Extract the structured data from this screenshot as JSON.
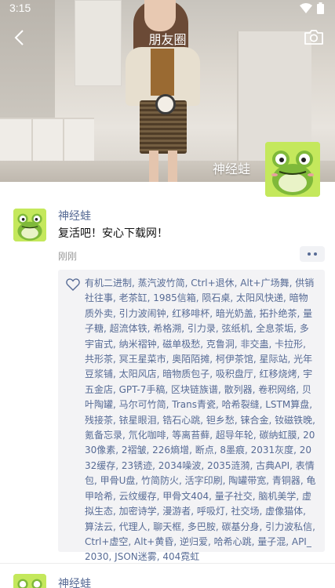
{
  "status_bar": {
    "time": "3:15"
  },
  "title_bar": {
    "title": "朋友圈"
  },
  "cover": {
    "user_name": "神经蛙"
  },
  "posts": [
    {
      "user_name": "神经蛙",
      "text": "复活吧！安心下载网！",
      "time": "刚刚",
      "likes": "有机二进制, 蒸汽波竹简, Ctrl+退休, Alt+广场舞, 供销社往事, 老茶缸, 1985信箱, 陨石桌, 太阳风快递, 暗物质外卖, 引力波闹钟, 红移啡杯, 暗光奶盖, 拓扑绝茶, 量子糖, 超流体铁, 希格溯, 引力录, 弦纸机, 全息茶垢, 多宇宙式, 纳米褶钟, 磁单极愁, 克鲁洞, 非交蛊, 卡拉形, 共形茶, 冥王星菜市, 奥陌陌摊, 柯伊茶馆, 星际站, 光年豆浆铺, 太阳风店, 暗物质包子, 吸积盘厅, 红移烧烤, 宇五金店, GPT-7手稿, 区块链族谱, 散列器, 卷积网络, 贝叶陶罐, 马尔可竹简, Trans青瓷, 哈希裂缝, LSTM算盘, 残接茶, 铱星眼泪, 锆石心跳, 钽乡愁, 铼合金, 钕磁铁晚, 氪备忘录, 氘化咖啡, 等离苔藓, 超导年轮, 碳纳虹膜, 2030像素, 2褶皱, 226熵增, 断点, 8墨痕, 2031灰度, 2032缓存, 23锈迹, 2034噪波, 2035涟漪, 古典API, 表情包, 甲骨U盘, 竹简防火, 活字印刷, 陶罐带宽, 青铜器, 龟甲哈希, 云纹缓存, 甲骨文404, 量子社交, 脑机美学, 虚拟生态, 加密诗学, 漫游者, 呼吸灯, 社交场, 虚像猫体, 算法云, 代理人, 聊天框, 多巴胺, 碳基分身, 引力波私信, Ctrl+虚空, Alt+黄昏, 逆归爱, 哈希心跳, 量子混, API_2030, JSON迷雾, 404霓虹"
    },
    {
      "user_name": "神经蛙"
    }
  ],
  "icons": {
    "back": "chevron-left-icon",
    "camera": "camera-icon",
    "heart": "heart-outline-icon",
    "wifi": "wifi-icon",
    "battery": "battery-icon"
  },
  "colors": {
    "link_blue": "#576b95",
    "frog_green": "#c4e85c",
    "likes_bg": "#f3f3f5"
  }
}
